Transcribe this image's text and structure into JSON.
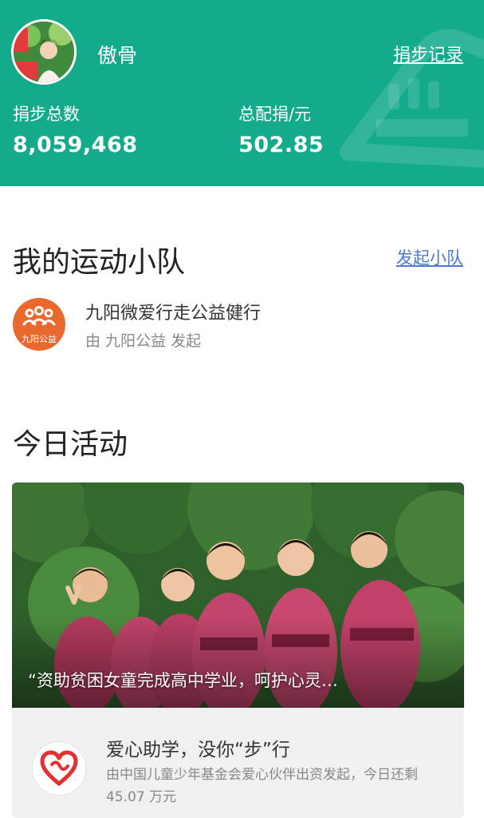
{
  "header": {
    "username": "傲骨",
    "record_link": "捐步记录",
    "stats": [
      {
        "label": "捐步总数",
        "value": "8,059,468"
      },
      {
        "label": "总配捐/元",
        "value": "502.85"
      }
    ],
    "colors": {
      "background": "#14ab8d"
    }
  },
  "team_section": {
    "title": "我的运动小队",
    "start_link": "发起小队",
    "team": {
      "name": "九阳微爱行走公益健行",
      "subtitle": "由 九阳公益 发起",
      "logo_text": "九阳公益",
      "logo_color": "#e8682d"
    }
  },
  "activity_section": {
    "title": "今日活动",
    "card": {
      "quote": "“资助贫困女童完成高中学业，呵护心灵…",
      "title": "爱心助学，没你“步”行",
      "description": "由中国儿童少年基金会爱心伙伴出资发起，今日还剩 45.07 万元",
      "logo_color": "#e33030"
    }
  }
}
